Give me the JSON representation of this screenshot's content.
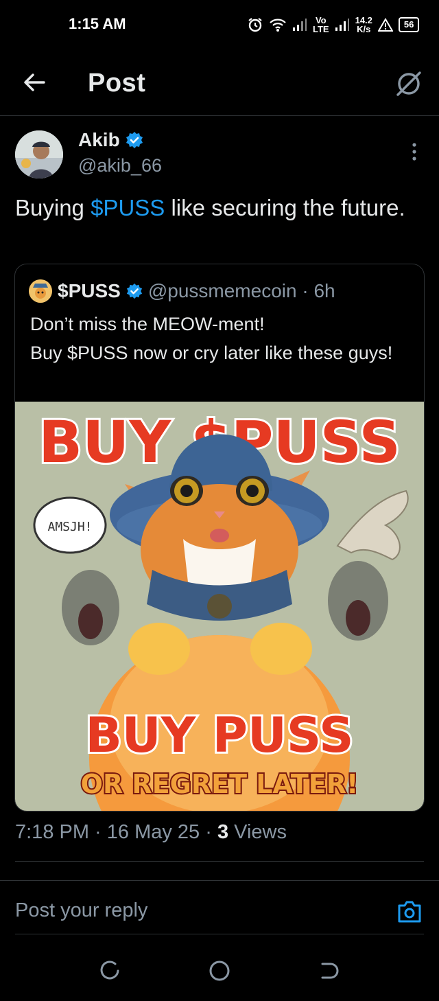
{
  "status_bar": {
    "time": "1:15 AM",
    "network_top": "Vo",
    "network_bottom": "LTE",
    "speed_value": "14.2",
    "speed_unit": "K/s",
    "battery": "56",
    "icons": [
      "alarm-icon",
      "wifi-icon",
      "signal-icon",
      "signal-icon",
      "warning-icon",
      "battery-icon"
    ]
  },
  "header": {
    "title": "Post",
    "back_icon": "back-arrow-icon",
    "right_icon": "grok-icon"
  },
  "post": {
    "author_name": "Akib",
    "author_handle": "@akib_66",
    "text_before": "Buying ",
    "cashtag": "$PUSS",
    "text_after": " like securing the future.",
    "timestamp": "7:18 PM · 16 May 25 · ",
    "views_count": "3",
    "views_label": " Views"
  },
  "quote": {
    "name": "$PUSS",
    "handle": "@pussmemecoin · 6h",
    "line1": "Don’t miss the MEOW-ment!",
    "line2": "Buy $PUSS now or cry later like these guys!",
    "image": {
      "top_text": "BUY $PUSS",
      "speech_bubble": "AMSJH!",
      "bottom_text": "BUY PUSS",
      "bottom_subtext": "OR REGRET LATER!"
    }
  },
  "reply": {
    "placeholder": "Post your reply"
  },
  "colors": {
    "accent": "#1d9bf0",
    "background": "#000000",
    "text_primary": "#e7e9ea",
    "text_secondary": "#8b98a5",
    "divider": "#2f3336"
  }
}
